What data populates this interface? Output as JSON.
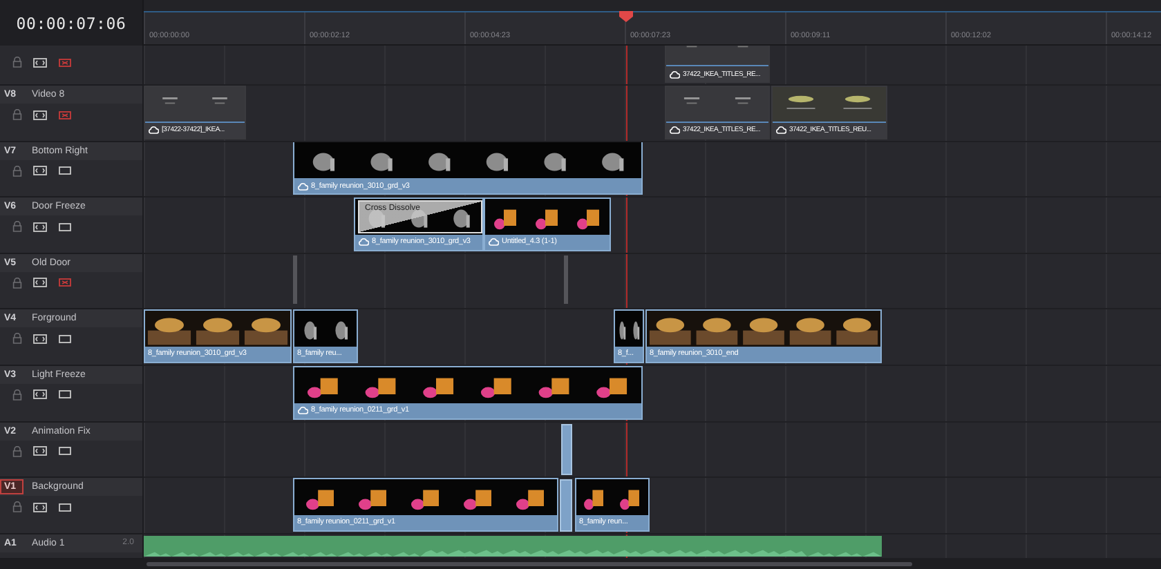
{
  "timecode": "00:00:07:06",
  "ruler": [
    "00:00:00:00",
    "00:00:02:12",
    "00:00:04:23",
    "00:00:07:23",
    "00:00:09:11",
    "00:00:12:02",
    "00:00:14:12"
  ],
  "tracks": [
    {
      "kind": "video",
      "video_on": false,
      "clips": [
        {
          "kind": "title",
          "label": "37422_IKEA_TITLES_RE...",
          "synced": true
        }
      ]
    },
    {
      "kind": "video",
      "id": "V8",
      "name": "Video 8",
      "destination": false,
      "video_on": false,
      "clips": [
        {
          "kind": "title",
          "label": "[37422-37422]_IKEA...",
          "synced": true
        },
        {
          "kind": "title",
          "label": "37422_IKEA_TITLES_RE...",
          "synced": true
        },
        {
          "kind": "title",
          "label": "37422_IKEA_TITLES_REU...",
          "synced": true
        }
      ]
    },
    {
      "kind": "video",
      "id": "V7",
      "name": "Bottom Right",
      "destination": false,
      "video_on": true,
      "clips": [
        {
          "kind": "video",
          "label": "8_family reunion_3010_grd_v3",
          "synced": true
        }
      ]
    },
    {
      "kind": "video",
      "id": "V6",
      "name": "Door Freeze",
      "destination": false,
      "video_on": true,
      "clips": [
        {
          "kind": "video",
          "label": "8_family reunion_3010_grd_v3",
          "synced": true,
          "transition": "Cross Dissolve"
        },
        {
          "kind": "video",
          "label": "Untitled_4.3 (1-1)",
          "synced": true
        }
      ]
    },
    {
      "kind": "video",
      "id": "V5",
      "name": "Old Door",
      "destination": false,
      "video_on": false,
      "clips": [
        {
          "kind": "marker"
        },
        {
          "kind": "marker"
        }
      ]
    },
    {
      "kind": "video",
      "id": "V4",
      "name": "Forground",
      "destination": false,
      "video_on": true,
      "clips": [
        {
          "kind": "video",
          "label": "8_family reunion_3010_grd_v3",
          "synced": false
        },
        {
          "kind": "video",
          "label": "8_family reu...",
          "synced": false
        },
        {
          "kind": "video",
          "label": "8_f...",
          "synced": false
        },
        {
          "kind": "video",
          "label": "8_family reunion_3010_end",
          "synced": false
        }
      ]
    },
    {
      "kind": "video",
      "id": "V3",
      "name": "Light Freeze",
      "destination": false,
      "video_on": true,
      "clips": [
        {
          "kind": "video",
          "label": "8_family reunion_0211_grd_v1",
          "synced": true
        }
      ]
    },
    {
      "kind": "video",
      "id": "V2",
      "name": "Animation Fix",
      "destination": false,
      "video_on": true,
      "clips": [
        {
          "kind": "sliver"
        }
      ]
    },
    {
      "kind": "video",
      "id": "V1",
      "name": "Background",
      "destination": true,
      "video_on": true,
      "clips": [
        {
          "kind": "video",
          "label": "8_family reunion_0211_grd_v1",
          "synced": false
        },
        {
          "kind": "sliver"
        },
        {
          "kind": "video",
          "label": "8_family reun...",
          "synced": false
        }
      ]
    },
    {
      "kind": "audio",
      "id": "A1",
      "name": "Audio 1",
      "channels": "2.0",
      "clips": [
        {
          "kind": "audio"
        }
      ]
    }
  ]
}
